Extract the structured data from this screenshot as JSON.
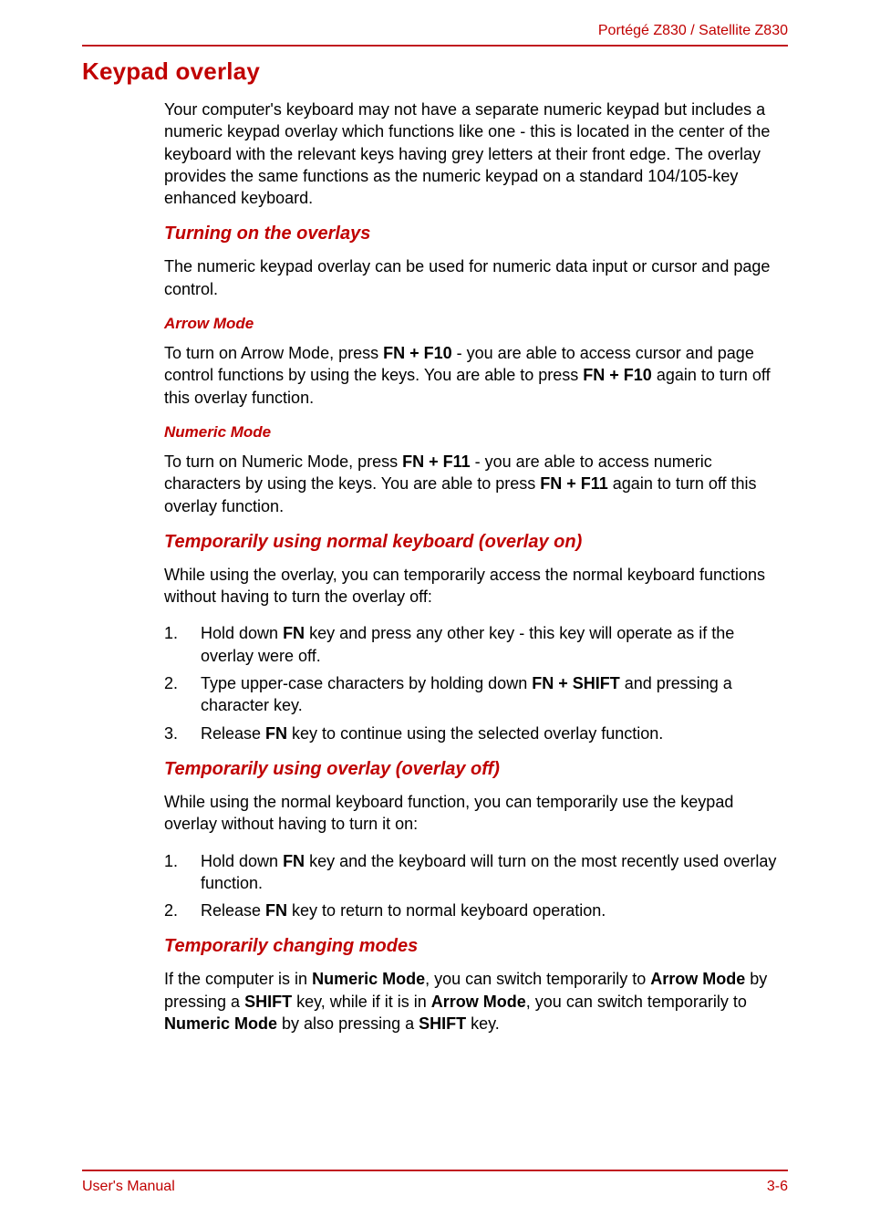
{
  "header": {
    "product_line": "Portégé Z830 / Satellite Z830"
  },
  "h1": "Keypad overlay",
  "intro": "Your computer's keyboard may not have a separate numeric keypad but includes a numeric keypad overlay which functions like one - this is located in the center of the keyboard with the relevant keys having grey letters at their front edge. The overlay provides the same functions as the numeric keypad on a standard 104/105-key enhanced keyboard.",
  "sections": {
    "s1": {
      "title": "Turning on the overlays",
      "para": "The numeric keypad overlay can be used for numeric data input or cursor and page control.",
      "sub1": {
        "title": "Arrow Mode",
        "pre": "To turn on Arrow Mode, press ",
        "key1": "FN + F10",
        "mid": " - you are able to access cursor and page control functions by using the keys. You are able to press ",
        "key2": "FN + F10",
        "post": " again to turn off this overlay function."
      },
      "sub2": {
        "title": "Numeric Mode",
        "pre": "To turn on Numeric Mode, press ",
        "key1": "FN + F11",
        "mid": " - you are able to access numeric characters by using the keys. You are able to press ",
        "key2": "FN + F11",
        "post": " again to turn off this overlay function."
      }
    },
    "s2": {
      "title": "Temporarily using normal keyboard (overlay on)",
      "para": "While using the overlay, you can temporarily access the normal keyboard functions without having to turn the overlay off:",
      "items": [
        {
          "num": "1.",
          "pre": "Hold down ",
          "b1": "FN",
          "post": " key and press any other key - this key will operate as if the overlay were off."
        },
        {
          "num": "2.",
          "pre": "Type upper-case characters by holding down ",
          "b1": "FN + SHIFT",
          "post": " and pressing a character key."
        },
        {
          "num": "3.",
          "pre": "Release ",
          "b1": "FN",
          "post": " key to continue using the selected overlay function."
        }
      ]
    },
    "s3": {
      "title": "Temporarily using overlay (overlay off)",
      "para": "While using the normal keyboard function, you can temporarily use the keypad overlay without having to turn it on:",
      "items": [
        {
          "num": "1.",
          "pre": "Hold down ",
          "b1": "FN",
          "post": " key and the keyboard will turn on the most recently used overlay function."
        },
        {
          "num": "2.",
          "pre": "Release ",
          "b1": "FN",
          "post": " key to return to normal keyboard operation."
        }
      ]
    },
    "s4": {
      "title": "Temporarily changing modes",
      "p": {
        "t1": "If the computer is in ",
        "b1": "Numeric Mode",
        "t2": ", you can switch temporarily to ",
        "b2": "Arrow Mode",
        "t3": " by pressing a ",
        "b3": "SHIFT",
        "t4": " key, while if it is in ",
        "b4": "Arrow Mode",
        "t5": ", you can switch temporarily to ",
        "b5": "Numeric Mode",
        "t6": " by also pressing a ",
        "b6": "SHIFT",
        "t7": " key."
      }
    }
  },
  "footer": {
    "left": "User's Manual",
    "right": "3-6"
  }
}
